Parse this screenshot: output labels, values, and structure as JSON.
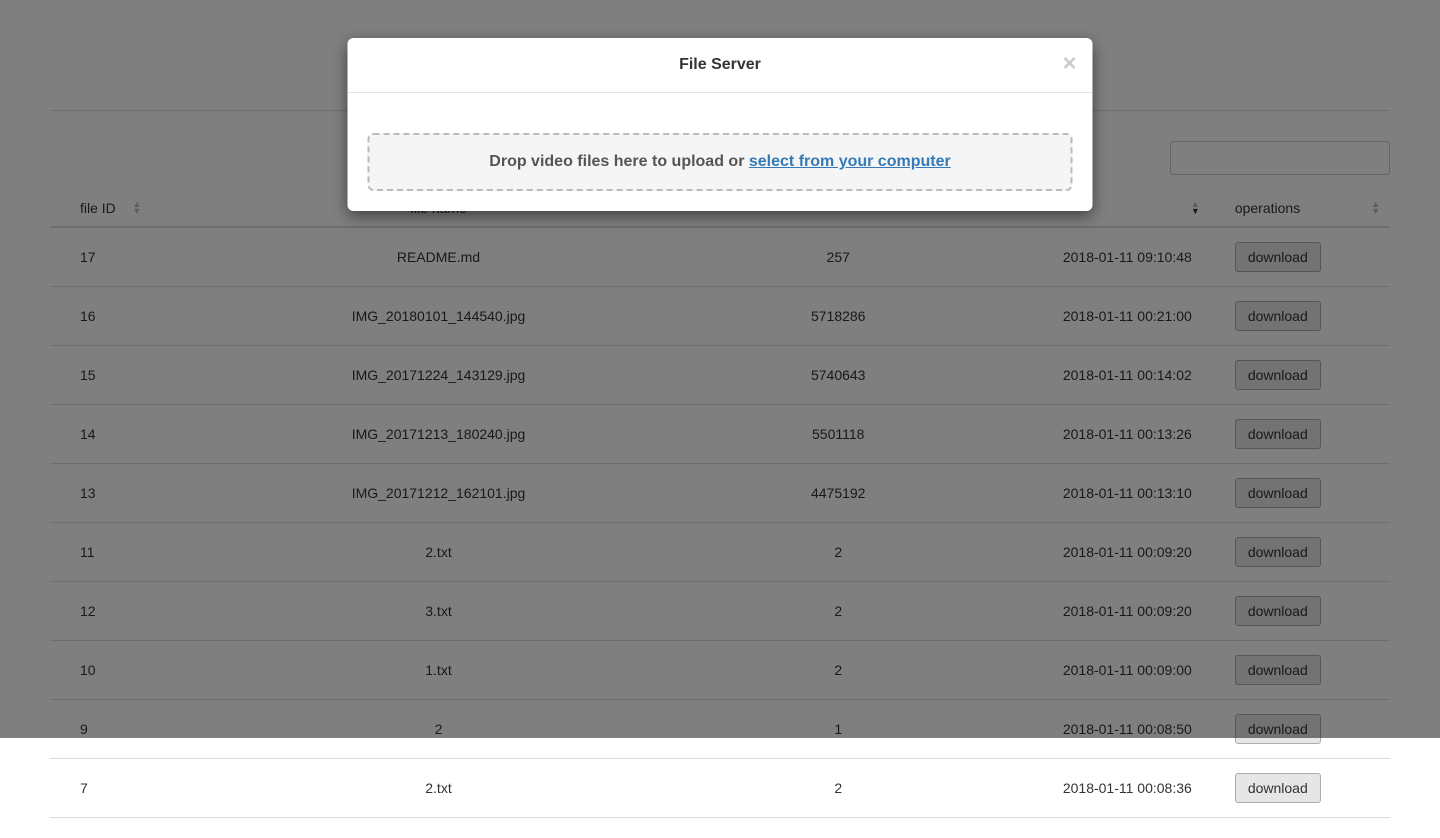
{
  "modal": {
    "title": "File Server",
    "drop_text": "Drop video files here to upload or ",
    "select_link": "select from your computer"
  },
  "table": {
    "headers": {
      "file_id": "file ID",
      "file_name": "file name",
      "file_size": "",
      "upload_time": "",
      "operations": "operations"
    },
    "download_label": "download",
    "rows": [
      {
        "id": "17",
        "name": "README.md",
        "size": "257",
        "time": "2018-01-11 09:10:48"
      },
      {
        "id": "16",
        "name": "IMG_20180101_144540.jpg",
        "size": "5718286",
        "time": "2018-01-11 00:21:00"
      },
      {
        "id": "15",
        "name": "IMG_20171224_143129.jpg",
        "size": "5740643",
        "time": "2018-01-11 00:14:02"
      },
      {
        "id": "14",
        "name": "IMG_20171213_180240.jpg",
        "size": "5501118",
        "time": "2018-01-11 00:13:26"
      },
      {
        "id": "13",
        "name": "IMG_20171212_162101.jpg",
        "size": "4475192",
        "time": "2018-01-11 00:13:10"
      },
      {
        "id": "11",
        "name": "2.txt",
        "size": "2",
        "time": "2018-01-11 00:09:20"
      },
      {
        "id": "12",
        "name": "3.txt",
        "size": "2",
        "time": "2018-01-11 00:09:20"
      },
      {
        "id": "10",
        "name": "1.txt",
        "size": "2",
        "time": "2018-01-11 00:09:00"
      },
      {
        "id": "9",
        "name": "2",
        "size": "1",
        "time": "2018-01-11 00:08:50"
      },
      {
        "id": "7",
        "name": "2.txt",
        "size": "2",
        "time": "2018-01-11 00:08:36"
      }
    ]
  }
}
